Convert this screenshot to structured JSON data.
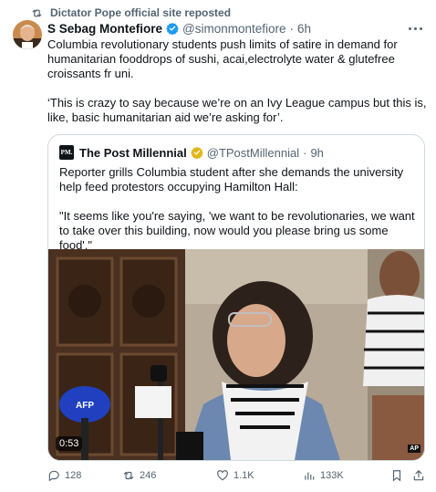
{
  "repost": {
    "label": "Dictator Pope official site reposted",
    "icon": "repost-icon"
  },
  "author": {
    "name": "S Sebag Montefiore",
    "handle": "@simonmontefiore",
    "time": "6h",
    "verified_icon": "verified-badge-icon"
  },
  "tweet": {
    "paragraph1": "Columbia revolutionary students push limits of satire in demand for humanitarian fooddrops of sushi, acai,electrolyte water & glutefree croissants fr uni.",
    "paragraph2": "‘This is crazy to say because we’re on an Ivy League campus but this is, like, basic humanitarian aid we’re asking for’."
  },
  "quote": {
    "logo_text": "PM.",
    "name": "The Post Millennial",
    "handle": "@TPostMillennial",
    "time": "9h",
    "paragraph1": "Reporter grills Columbia student after she demands the university help feed protestors occupying Hamilton Hall:",
    "paragraph2": "\"It seems like you're saying, 'we want to be revolutionaries, we want to take over this building, now would you please bring us some food'.\"",
    "video": {
      "duration": "0:53",
      "mic_label": "AFP",
      "watermark": "AP"
    }
  },
  "actions": {
    "replies": "128",
    "reposts": "246",
    "likes": "1.1K",
    "views": "133K"
  },
  "colors": {
    "text": "#0f1419",
    "secondary": "#536471",
    "verified": "#1d9bf0",
    "border": "#cfd9de"
  }
}
